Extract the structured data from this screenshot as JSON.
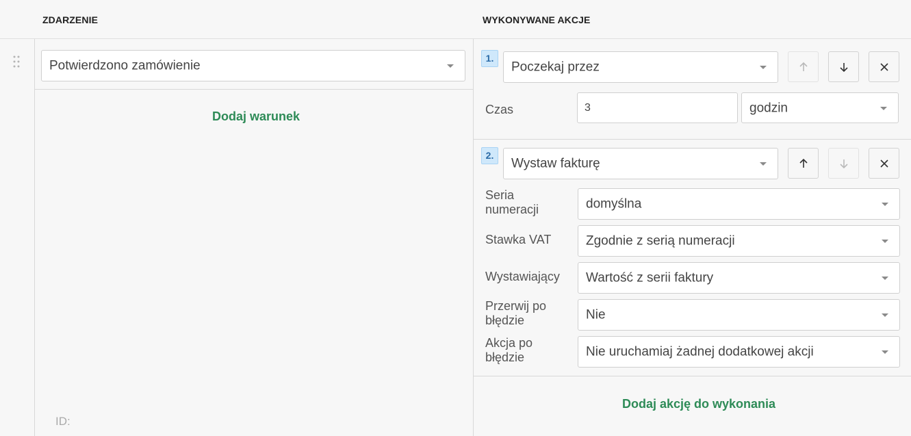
{
  "header": {
    "event_col": "ZDARZENIE",
    "actions_col": "WYKONYWANE AKCJE"
  },
  "event": {
    "trigger": "Potwierdzono zamówienie",
    "add_condition": "Dodaj warunek",
    "id_label": "ID:"
  },
  "actions": [
    {
      "number": "1.",
      "type": "Poczekaj przez",
      "fields": {
        "time_label": "Czas",
        "time_value": "3",
        "unit": "godzin"
      }
    },
    {
      "number": "2.",
      "type": "Wystaw fakturę",
      "fields": [
        {
          "label": "Seria numeracji",
          "value": "domyślna"
        },
        {
          "label": "Stawka VAT",
          "value": "Zgodnie z serią numeracji"
        },
        {
          "label": "Wystawiający",
          "value": "Wartość z serii faktury"
        },
        {
          "label": "Przerwij po błędzie",
          "value": "Nie"
        },
        {
          "label": "Akcja po błędzie",
          "value": "Nie uruchamiaj żadnej dodatkowej akcji"
        }
      ]
    }
  ],
  "add_action": "Dodaj akcję do wykonania",
  "colors": {
    "accent_green": "#2e8b57",
    "badge_bg": "#cfe8fb",
    "badge_text": "#2a6aa6"
  }
}
